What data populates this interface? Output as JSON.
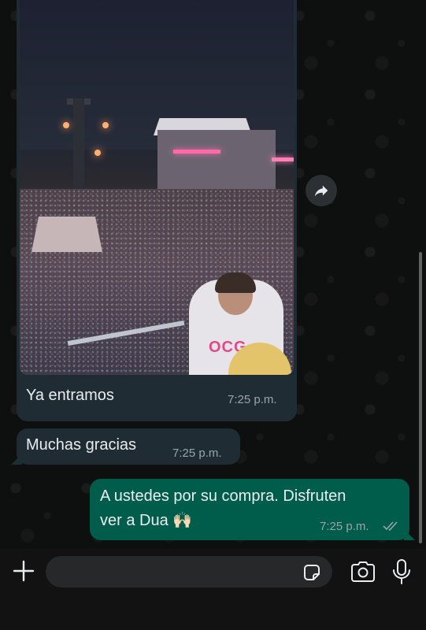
{
  "chat": {
    "messages": [
      {
        "direction": "incoming",
        "type": "image",
        "caption": "Ya entramos",
        "time": "7:25 p.m.",
        "shirt_text": "OCG"
      },
      {
        "direction": "incoming",
        "type": "text",
        "text": "Muchas gracias",
        "time": "7:25 p.m."
      },
      {
        "direction": "outgoing",
        "type": "text",
        "text_line1": "A ustedes por su compra. Disfruten",
        "text_line2": "ver a Dua",
        "emoji": "🙌🏻",
        "time": "7:25 p.m.",
        "status": "read"
      }
    ]
  },
  "input_bar": {
    "placeholder": "",
    "icons": [
      "plus-icon",
      "sticker-icon",
      "camera-icon",
      "microphone-icon"
    ]
  },
  "colors": {
    "incoming_bubble": "#202c33",
    "outgoing_bubble": "#005c4b",
    "background": "#0e0f0f",
    "read_ticks": "#9aa4a9"
  }
}
